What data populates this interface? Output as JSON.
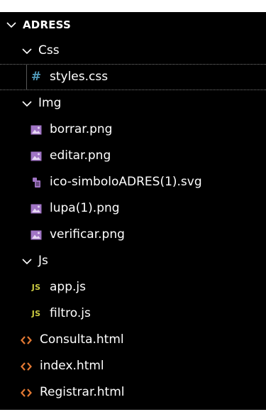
{
  "explorer": {
    "root": {
      "label": "ADRESS"
    },
    "folders": {
      "css": {
        "label": "Css"
      },
      "img": {
        "label": "Img"
      },
      "js": {
        "label": "Js"
      }
    },
    "files": {
      "styles_css": {
        "label": "styles.css",
        "icon": "hash-icon",
        "icon_text": "#"
      },
      "borrar_png": {
        "label": "borrar.png",
        "icon": "image-icon"
      },
      "editar_png": {
        "label": "editar.png",
        "icon": "image-icon"
      },
      "ico_svg": {
        "label": "ico-simboloADRES(1).svg",
        "icon": "svg-file-icon"
      },
      "lupa_png": {
        "label": "lupa(1).png",
        "icon": "image-icon"
      },
      "verificar_png": {
        "label": "verificar.png",
        "icon": "image-icon"
      },
      "app_js": {
        "label": "app.js",
        "icon": "js-icon",
        "icon_text": "JS"
      },
      "filtro_js": {
        "label": "filtro.js",
        "icon": "js-icon",
        "icon_text": "JS"
      },
      "consulta_html": {
        "label": "Consulta.html",
        "icon": "html-icon"
      },
      "index_html": {
        "label": "index.html",
        "icon": "html-icon"
      },
      "registrar_html": {
        "label": "Registrar.html",
        "icon": "html-icon"
      }
    }
  },
  "colors": {
    "background": "#000000",
    "text": "#ffffff",
    "css_icon": "#519aba",
    "image_icon": "#a074c4",
    "js_icon": "#cbcb41",
    "html_icon": "#e37933"
  }
}
